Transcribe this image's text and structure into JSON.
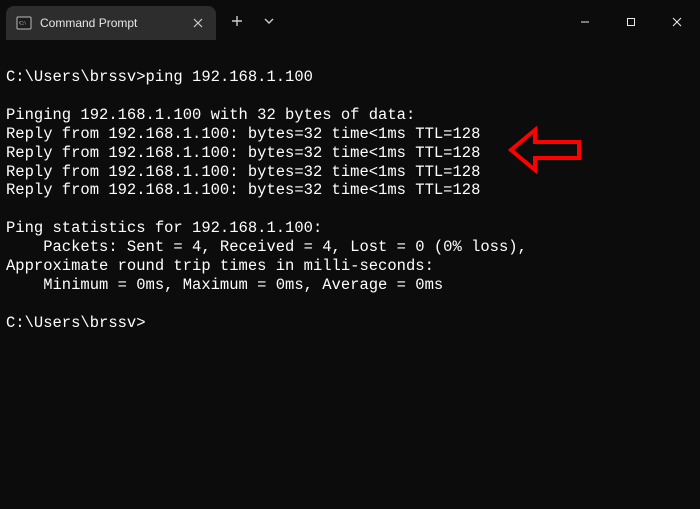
{
  "tab": {
    "title": "Command Prompt"
  },
  "prompt": "C:\\Users\\brssv>",
  "command": "ping 192.168.1.100",
  "output": {
    "header": "Pinging 192.168.1.100 with 32 bytes of data:",
    "replies": [
      "Reply from 192.168.1.100: bytes=32 time<1ms TTL=128",
      "Reply from 192.168.1.100: bytes=32 time<1ms TTL=128",
      "Reply from 192.168.1.100: bytes=32 time<1ms TTL=128",
      "Reply from 192.168.1.100: bytes=32 time<1ms TTL=128"
    ],
    "stats_header": "Ping statistics for 192.168.1.100:",
    "packets": "    Packets: Sent = 4, Received = 4, Lost = 0 (0% loss),",
    "rtt_header": "Approximate round trip times in milli-seconds:",
    "rtt_values": "    Minimum = 0ms, Maximum = 0ms, Average = 0ms"
  },
  "annotation": {
    "color": "#ff0000"
  }
}
